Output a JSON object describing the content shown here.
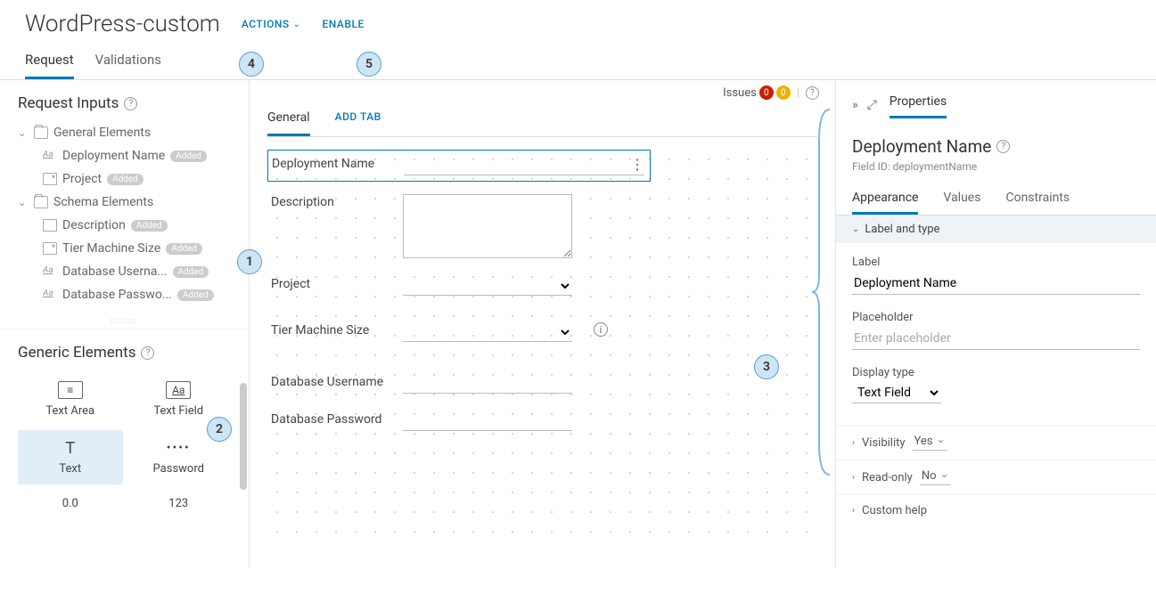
{
  "header": {
    "title": "WordPress-custom",
    "actions_label": "ACTIONS",
    "enable_label": "ENABLE"
  },
  "callouts": {
    "c1": "1",
    "c2": "2",
    "c3": "3",
    "c4": "4",
    "c5": "5"
  },
  "main_tabs": {
    "request": "Request",
    "validations": "Validations"
  },
  "left": {
    "request_inputs_title": "Request Inputs",
    "general_elements": "General Elements",
    "schema_elements": "Schema Elements",
    "items_general": [
      {
        "label": "Deployment Name",
        "badge": "Added",
        "icon": "text"
      },
      {
        "label": "Project",
        "badge": "Added",
        "icon": "combo"
      }
    ],
    "items_schema": [
      {
        "label": "Description",
        "badge": "Added",
        "icon": "area"
      },
      {
        "label": "Tier Machine Size",
        "badge": "Added",
        "icon": "combo"
      },
      {
        "label": "Database Userna...",
        "badge": "Added",
        "icon": "text"
      },
      {
        "label": "Database Passwo...",
        "badge": "Added",
        "icon": "text"
      }
    ],
    "generic_elements_title": "Generic Elements",
    "generic": [
      {
        "label": "Text Area",
        "glyph": "≡"
      },
      {
        "label": "Text Field",
        "glyph": "Aa"
      },
      {
        "label": "Text",
        "glyph": "T"
      },
      {
        "label": "Password",
        "glyph": "••••"
      },
      {
        "label": "0.0",
        "glyph": ""
      },
      {
        "label": "123",
        "glyph": ""
      }
    ]
  },
  "center": {
    "issues_label": "Issues",
    "issues_red": "0",
    "issues_yellow": "0",
    "tab_general": "General",
    "tab_add": "ADD TAB",
    "rows": {
      "deployment_name": "Deployment Name",
      "description": "Description",
      "project": "Project",
      "tier_machine": "Tier Machine Size",
      "db_user": "Database Username",
      "db_pass": "Database Password"
    }
  },
  "right": {
    "properties_tab": "Properties",
    "title": "Deployment Name",
    "field_id": "Field ID: deploymentName",
    "tabs": {
      "appearance": "Appearance",
      "values": "Values",
      "constraints": "Constraints"
    },
    "section_label_type": "Label and type",
    "label_label": "Label",
    "label_value": "Deployment Name",
    "placeholder_label": "Placeholder",
    "placeholder_ph": "Enter placeholder",
    "display_type_label": "Display type",
    "display_type_value": "Text Field",
    "visibility_label": "Visibility",
    "visibility_value": "Yes",
    "readonly_label": "Read-only",
    "readonly_value": "No",
    "custom_help": "Custom help"
  }
}
